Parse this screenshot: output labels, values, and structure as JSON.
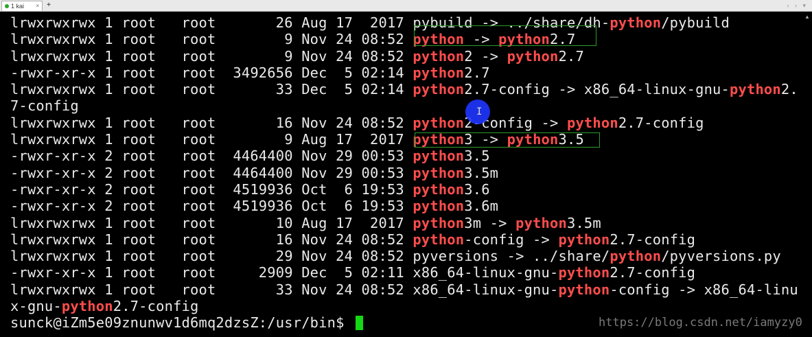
{
  "tab": {
    "label": "1 kai",
    "close_glyph": "×",
    "new_glyph": "+",
    "nav_glyphs": "‹ › ▾"
  },
  "terminal": {
    "lines": [
      [
        {
          "t": "lrwxrwxrwx 1 root   root       26 Aug 17  2017 pybuild -> ../share/dh-"
        },
        {
          "t": "python",
          "hl": true
        },
        {
          "t": "/pybuild"
        }
      ],
      [
        {
          "t": "lrwxrwxrwx 1 root   root        9 Nov 24 08:52 "
        },
        {
          "t": "python",
          "hl": true
        },
        {
          "t": " -> "
        },
        {
          "t": "python",
          "hl": true
        },
        {
          "t": "2.7"
        }
      ],
      [
        {
          "t": "lrwxrwxrwx 1 root   root        9 Nov 24 08:52 "
        },
        {
          "t": "python",
          "hl": true
        },
        {
          "t": "2 -> "
        },
        {
          "t": "python",
          "hl": true
        },
        {
          "t": "2.7"
        }
      ],
      [
        {
          "t": "-rwxr-xr-x 1 root   root  3492656 Dec  5 02:14 "
        },
        {
          "t": "python",
          "hl": true
        },
        {
          "t": "2.7"
        }
      ],
      [
        {
          "t": "lrwxrwxrwx 1 root   root       33 Dec  5 02:14 "
        },
        {
          "t": "python",
          "hl": true
        },
        {
          "t": "2.7-config -> x86_64-linux-gnu-"
        },
        {
          "t": "python",
          "hl": true
        },
        {
          "t": "2."
        }
      ],
      [
        {
          "t": "7-config"
        }
      ],
      [
        {
          "t": "lrwxrwxrwx 1 root   root       16 Nov 24 08:52 "
        },
        {
          "t": "python",
          "hl": true
        },
        {
          "t": "2-config -> "
        },
        {
          "t": "python",
          "hl": true
        },
        {
          "t": "2.7-config"
        }
      ],
      [
        {
          "t": "lrwxrwxrwx 1 root   root        9 Aug 17  2017 "
        },
        {
          "t": "python",
          "hl": true
        },
        {
          "t": "3 -> "
        },
        {
          "t": "python",
          "hl": true
        },
        {
          "t": "3.5"
        }
      ],
      [
        {
          "t": "-rwxr-xr-x 2 root   root  4464400 Nov 29 00:53 "
        },
        {
          "t": "python",
          "hl": true
        },
        {
          "t": "3.5"
        }
      ],
      [
        {
          "t": "-rwxr-xr-x 2 root   root  4464400 Nov 29 00:53 "
        },
        {
          "t": "python",
          "hl": true
        },
        {
          "t": "3.5m"
        }
      ],
      [
        {
          "t": "-rwxr-xr-x 2 root   root  4519936 Oct  6 19:53 "
        },
        {
          "t": "python",
          "hl": true
        },
        {
          "t": "3.6"
        }
      ],
      [
        {
          "t": "-rwxr-xr-x 2 root   root  4519936 Oct  6 19:53 "
        },
        {
          "t": "python",
          "hl": true
        },
        {
          "t": "3.6m"
        }
      ],
      [
        {
          "t": "lrwxrwxrwx 1 root   root       10 Aug 17  2017 "
        },
        {
          "t": "python",
          "hl": true
        },
        {
          "t": "3m -> "
        },
        {
          "t": "python",
          "hl": true
        },
        {
          "t": "3.5m"
        }
      ],
      [
        {
          "t": "lrwxrwxrwx 1 root   root       16 Nov 24 08:52 "
        },
        {
          "t": "python",
          "hl": true
        },
        {
          "t": "-config -> "
        },
        {
          "t": "python",
          "hl": true
        },
        {
          "t": "2.7-config"
        }
      ],
      [
        {
          "t": "lrwxrwxrwx 1 root   root       29 Nov 24 08:52 pyversions -> ../share/"
        },
        {
          "t": "python",
          "hl": true
        },
        {
          "t": "/pyversions.py"
        }
      ],
      [
        {
          "t": "-rwxr-xr-x 1 root   root     2909 Dec  5 02:11 x86_64-linux-gnu-"
        },
        {
          "t": "python",
          "hl": true
        },
        {
          "t": "2.7-config"
        }
      ],
      [
        {
          "t": "lrwxrwxrwx 1 root   root       33 Nov 24 08:52 x86_64-linux-gnu-"
        },
        {
          "t": "python",
          "hl": true
        },
        {
          "t": "-config -> x86_64-linu"
        }
      ],
      [
        {
          "t": "x-gnu-"
        },
        {
          "t": "python",
          "hl": true
        },
        {
          "t": "2.7-config"
        }
      ]
    ],
    "prompt": "sunck@iZm5e09znunwv1d6mq2dzsZ:/usr/bin$ ",
    "highlight_color": "#ff4d4d",
    "text_color": "#eaeaea",
    "cursor_color": "#15d815",
    "annotation_box_color": "#2c9c2c"
  },
  "watermark": "https://blog.csdn.net/iamyzy00"
}
